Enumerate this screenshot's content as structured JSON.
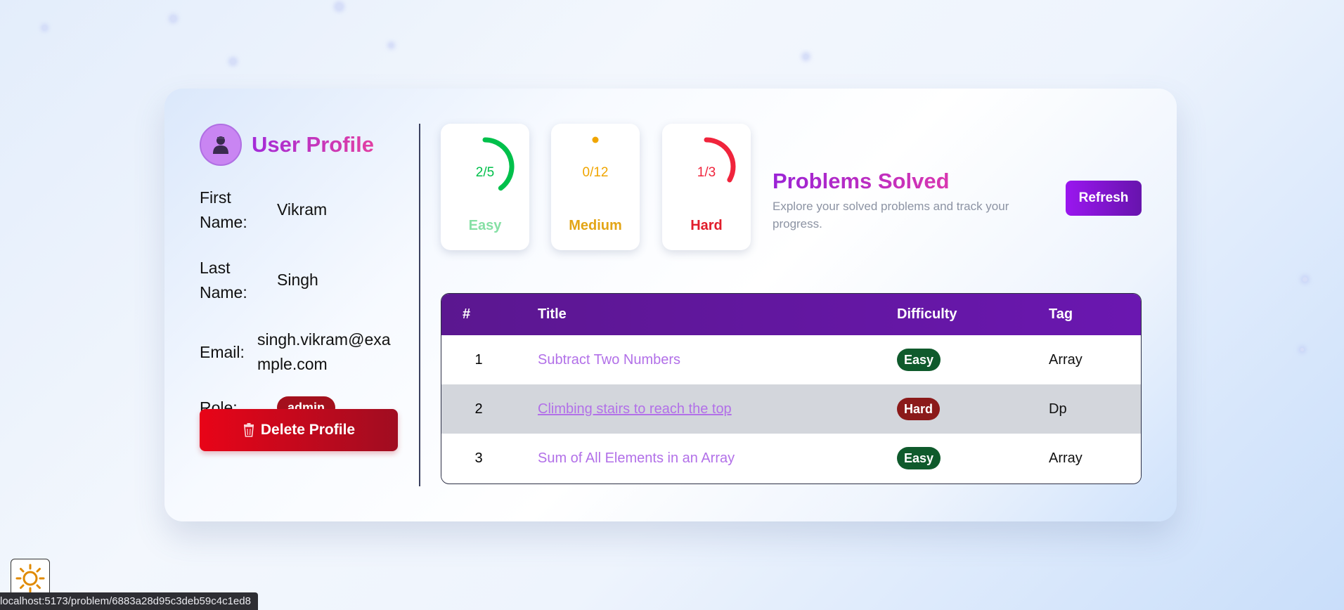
{
  "profile": {
    "title": "User Profile",
    "first_name_label": "First Name:",
    "first_name": "Vikram",
    "last_name_label": "Last Name:",
    "last_name": "Singh",
    "email_label": "Email:",
    "email": "singh.vikram@example.com",
    "role_label": "Role:",
    "role": "admin",
    "delete_label": "Delete Profile",
    "avatar_icon": "user-icon",
    "delete_icon": "trash-icon"
  },
  "stats": [
    {
      "label": "Easy",
      "count": "2/5",
      "solved": 2,
      "total": 5,
      "color": "#00c04b",
      "label_color": "#86e0a5"
    },
    {
      "label": "Medium",
      "count": "0/12",
      "solved": 0,
      "total": 12,
      "color": "#f0a500",
      "label_color": "#e3a516"
    },
    {
      "label": "Hard",
      "count": "1/3",
      "solved": 1,
      "total": 3,
      "color": "#f0243c",
      "label_color": "#e11d2b"
    }
  ],
  "solved": {
    "title": "Problems Solved",
    "subtitle": "Explore your solved problems and track your progress.",
    "refresh_label": "Refresh"
  },
  "table": {
    "headers": [
      "#",
      "Title",
      "Difficulty",
      "Tag"
    ],
    "rows": [
      {
        "num": "1",
        "title": "Subtract Two Numbers",
        "difficulty": "Easy",
        "tag": "Array"
      },
      {
        "num": "2",
        "title": "Climbing stairs to reach the top",
        "difficulty": "Hard",
        "tag": "Dp"
      },
      {
        "num": "3",
        "title": "Sum of All Elements in an Array",
        "difficulty": "Easy",
        "tag": "Array"
      }
    ]
  },
  "colors": {
    "easy_badge": "#0f5a2c",
    "hard_badge": "#8b1a1a",
    "row_hover": "#d3d6dc"
  },
  "theme_toggle_icon": "sun-icon",
  "status_url": "localhost:5173/problem/6883a28d95c3deb59c4c1ed8"
}
